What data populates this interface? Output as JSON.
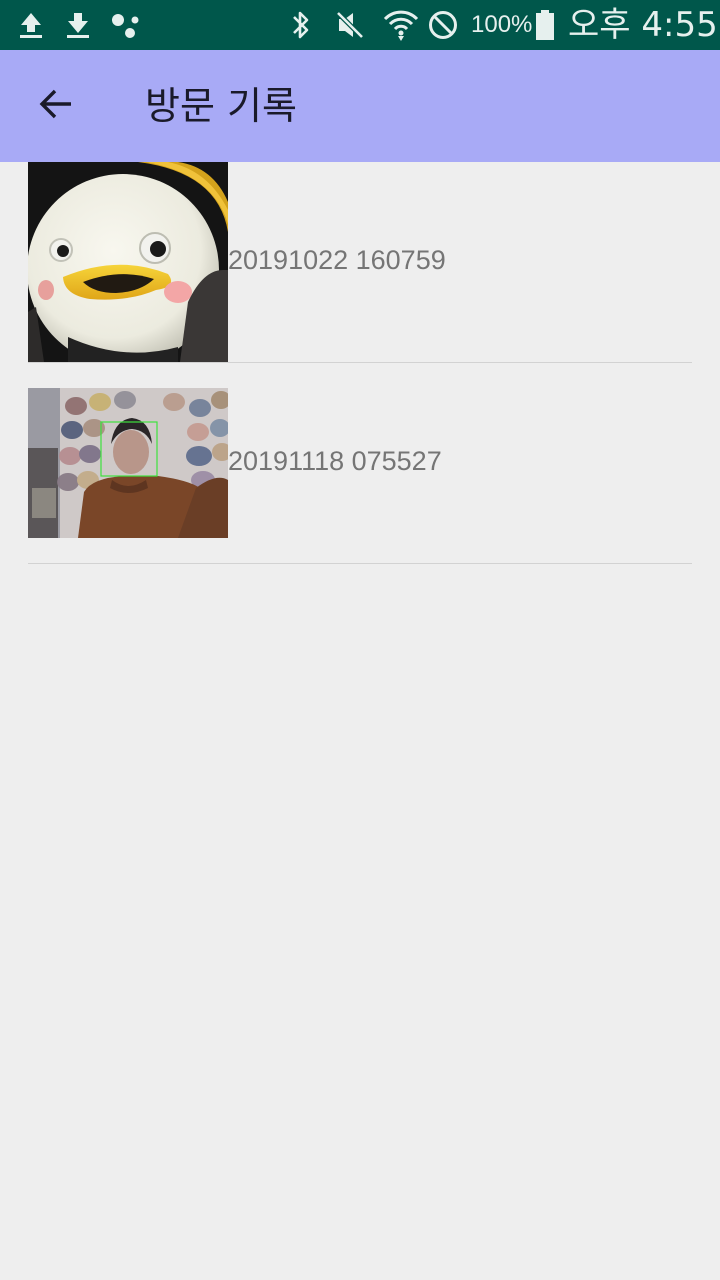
{
  "status_bar": {
    "icons": [
      "upload-icon",
      "download-icon",
      "assistant-dots-icon",
      "bluetooth-icon",
      "vibrate-off-icon",
      "wifi-icon",
      "do-not-disturb-icon",
      "battery-icon"
    ],
    "battery_percent": "100%",
    "time": "오후 4:55"
  },
  "app_bar": {
    "back_icon": "arrow-back-icon",
    "title": "방문 기록"
  },
  "records": [
    {
      "label": "20191022 160759"
    },
    {
      "label": "20191118 075527"
    }
  ],
  "colors": {
    "status_bar": "#00574b",
    "app_bar": "#a8aaf6",
    "background": "#eeeeee",
    "label_text": "#757575"
  }
}
